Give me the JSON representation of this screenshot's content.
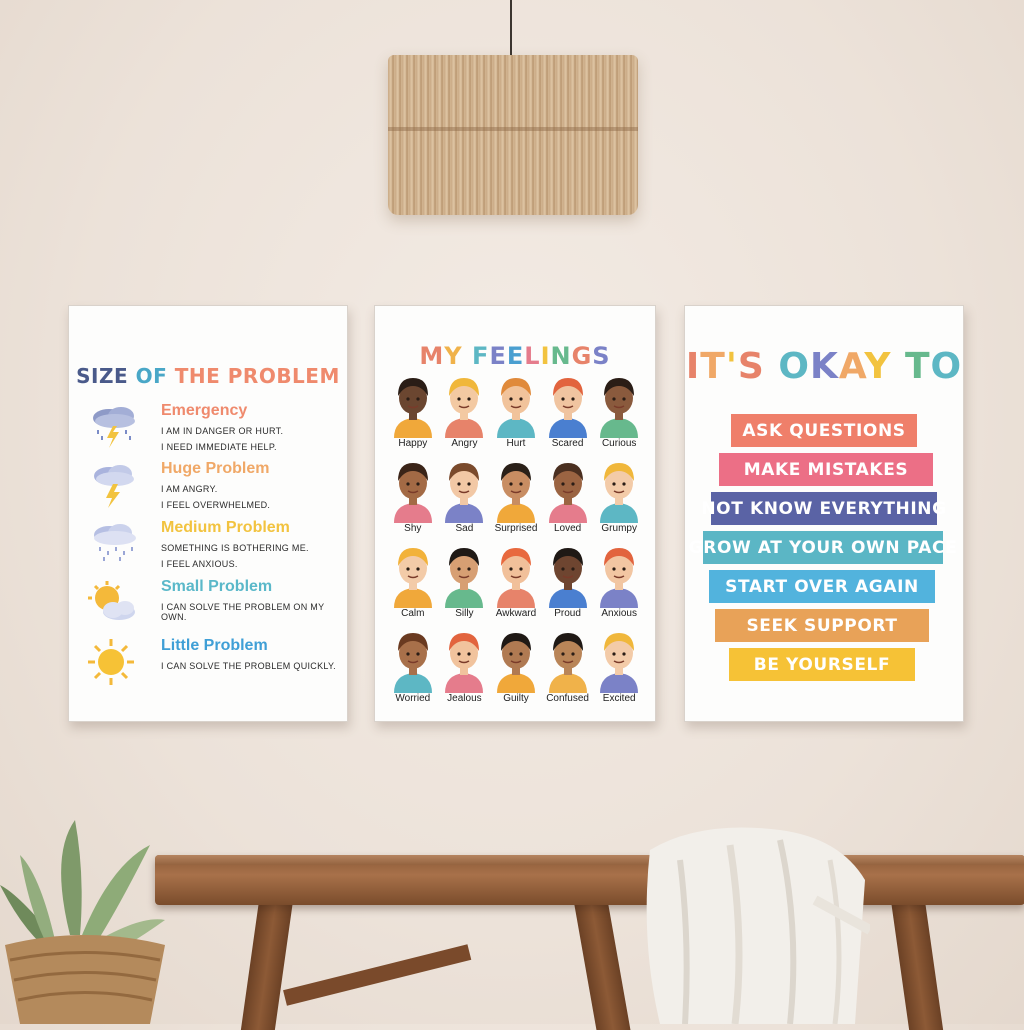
{
  "poster_left": {
    "title": [
      "SIZE",
      "OF",
      "THE PROBLEM"
    ],
    "problems": [
      {
        "name": "Emergency",
        "line1": "I AM IN DANGER OR HURT.",
        "line2": "I NEED IMMEDIATE HELP.",
        "color": "#ef8a6d",
        "icon": "storm-cloud-icon"
      },
      {
        "name": "Huge Problem",
        "line1": "I AM ANGRY.",
        "line2": "I FEEL OVERWHELMED.",
        "color": "#f0a867",
        "icon": "lightning-cloud-icon"
      },
      {
        "name": "Medium Problem",
        "line1": "SOMETHING IS BOTHERING ME.",
        "line2": "I FEEL ANXIOUS.",
        "color": "#f2c33f",
        "icon": "rain-cloud-icon"
      },
      {
        "name": "Small Problem",
        "line1": "I CAN SOLVE THE PROBLEM ON MY OWN.",
        "line2": "",
        "color": "#5ab8c9",
        "icon": "sun-cloud-icon"
      },
      {
        "name": "Little Problem",
        "line1": "I CAN SOLVE THE PROBLEM QUICKLY.",
        "line2": "",
        "color": "#3f9fd6",
        "icon": "sun-icon"
      }
    ]
  },
  "poster_middle": {
    "title": "MY FEELINGS",
    "title_colors": [
      "#e7836a",
      "#f0b24a",
      "#5db7c4",
      "#7b82c7",
      "#4a9fd0",
      "#e57c8c",
      "#f2c33f",
      "#67b98d",
      "#e7836a",
      "#7b82c7",
      "#5db7c4"
    ],
    "feelings": [
      "Happy",
      "Angry",
      "Hurt",
      "Scared",
      "Curious",
      "Shy",
      "Sad",
      "Surprised",
      "Loved",
      "Grumpy",
      "Calm",
      "Silly",
      "Awkward",
      "Proud",
      "Anxious",
      "Worried",
      "Jealous",
      "Guilty",
      "Confused",
      "Excited"
    ]
  },
  "poster_right": {
    "title": "IT'S OKAY TO",
    "title_colors": [
      "#e7836a",
      "#f0a867",
      "#f2c33f",
      "#e7836a",
      "#5db7c4",
      "#7b82c7",
      "#f0a867",
      "#f2c33f",
      "#67b98d",
      "#5db7c4",
      "#4a9fd0"
    ],
    "items": [
      {
        "text": "ASK QUESTIONS",
        "color": "#ef7f6a"
      },
      {
        "text": "MAKE MISTAKES",
        "color": "#ec6f86"
      },
      {
        "text": "NOT KNOW EVERYTHING",
        "color": "#5a63a5"
      },
      {
        "text": "GROW AT YOUR OWN PACE",
        "color": "#5bb6c5"
      },
      {
        "text": "START OVER AGAIN",
        "color": "#52b3dd"
      },
      {
        "text": "SEEK SUPPORT",
        "color": "#e8a258"
      },
      {
        "text": "BE YOURSELF",
        "color": "#f6c236"
      }
    ]
  }
}
